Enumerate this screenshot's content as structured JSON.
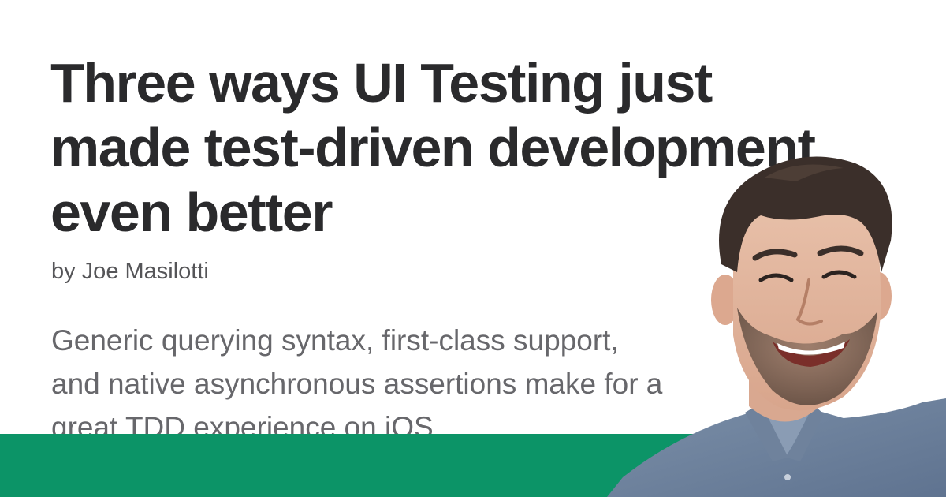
{
  "article": {
    "title": "Three ways UI Testing just made test-driven development even better",
    "byline": "by Joe Masilotti",
    "summary": "Generic querying syntax, first-class support, and native asynchronous assertions make for a great TDD experience on iOS."
  },
  "colors": {
    "title": "#2a2a2c",
    "byline": "#555558",
    "summary": "#67676b",
    "footer_band": "#0c9467",
    "background": "#ffffff"
  }
}
